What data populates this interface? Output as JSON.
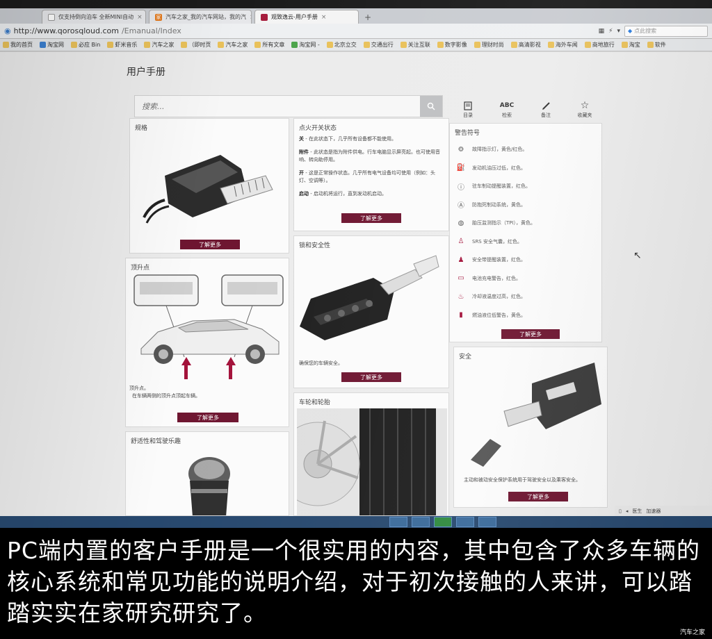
{
  "browser": {
    "tabs": [
      {
        "label": "仅支持倒向泊车 全新MINI自动",
        "favicon": "doc-icon"
      },
      {
        "label": "汽车之家_我的汽车网站，我的汽",
        "favicon": "autohome-icon"
      },
      {
        "label": "观致逸云-用户手册",
        "favicon": "qoros-icon",
        "active": true
      }
    ],
    "new_tab": "+",
    "url_host": "http://www.qorosqloud.com",
    "url_path": "/Emanual/Index",
    "search_placeholder": "点此搜索",
    "bookmarks": [
      "我的首页",
      "淘宝网",
      "必应 Bin",
      "虾米音乐",
      "汽车之家",
      "（即时页",
      "汽车之家",
      "所有文章",
      "淘宝网 -",
      "北京立交",
      "交通出行",
      "关注互联",
      "数字影像",
      "理财时尚",
      "高清影视",
      "海外车闻",
      "商地旅行",
      "淘宝",
      "软件"
    ]
  },
  "page": {
    "title": "用户手册",
    "search_placeholder": "搜索...",
    "tools": [
      {
        "icon": "book-icon",
        "label": "目录"
      },
      {
        "icon": "abc-icon",
        "glyph": "ABC",
        "label": "检索"
      },
      {
        "icon": "pen-icon",
        "label": "备注"
      },
      {
        "icon": "star-icon",
        "label": "收藏夹"
      }
    ],
    "more_label": "了解更多",
    "cards": {
      "spec": {
        "title": "规格"
      },
      "jack": {
        "title": "顶升点",
        "text1": "顶升点。",
        "text2": "在车辆两侧的顶升点顶起车辆。"
      },
      "comfort": {
        "title": "舒适性和驾驶乐趣"
      },
      "ignition": {
        "title": "点火开关状态",
        "off_key": "关",
        "off_text": " - 在此状态下，几乎所有设备都不能使用。",
        "acc_key": "附件",
        "acc_text": " - 此状态是指为附件供电。行车电脑显示屏亮起。也可使用音响、转向助停用。",
        "on_key": "开",
        "on_text": " - 这是正常操作状态。几乎所有电气设备均可使用（例如：头灯、空调等）。",
        "start_key": "启动",
        "start_text": " - 启动机将运行，直到发动机启动。"
      },
      "lock": {
        "title": "锁和安全性",
        "text": "确保您的车辆安全。"
      },
      "wheels": {
        "title": "车轮和轮胎"
      },
      "warning": {
        "title": "警告符号",
        "items": [
          {
            "icon": "engine-icon",
            "text": "故障指示灯，黄色/红色。"
          },
          {
            "icon": "oil-icon",
            "text": "发动机油压过低，红色。"
          },
          {
            "icon": "brake-icon",
            "text": "驻车制动提醒装置，红色。"
          },
          {
            "icon": "abs-icon",
            "text": "防抱死制动系统，黄色。"
          },
          {
            "icon": "tire-pressure-icon",
            "text": "胎压监测指示（TPI），黄色。"
          },
          {
            "icon": "srs-icon",
            "text": "SRS 安全气囊，红色。"
          },
          {
            "icon": "seatbelt-icon",
            "text": "安全带提醒装置，红色。"
          },
          {
            "icon": "battery-icon",
            "text": "电池充电警告，红色。"
          },
          {
            "icon": "coolant-icon",
            "text": "冷却液温度过高，红色。"
          },
          {
            "icon": "fuel-icon",
            "text": "燃油液位低警告，黄色。"
          }
        ]
      },
      "safety": {
        "title": "安全",
        "text": "主动和被动安全保护系统用于驾驶安全以及乘客安全。"
      }
    },
    "status_bar": [
      "医生",
      "加速器"
    ]
  },
  "caption": {
    "text": "PC端内置的客户手册是一个很实用的内容，其中包含了众多车辆的核心系统和常见功能的说明介绍，对于初次接触的人来讲，可以踏踏实实在家研究研究了。",
    "watermark": "汽车之家"
  },
  "colors": {
    "accent": "#6e1530",
    "arrow": "#a3123a"
  }
}
